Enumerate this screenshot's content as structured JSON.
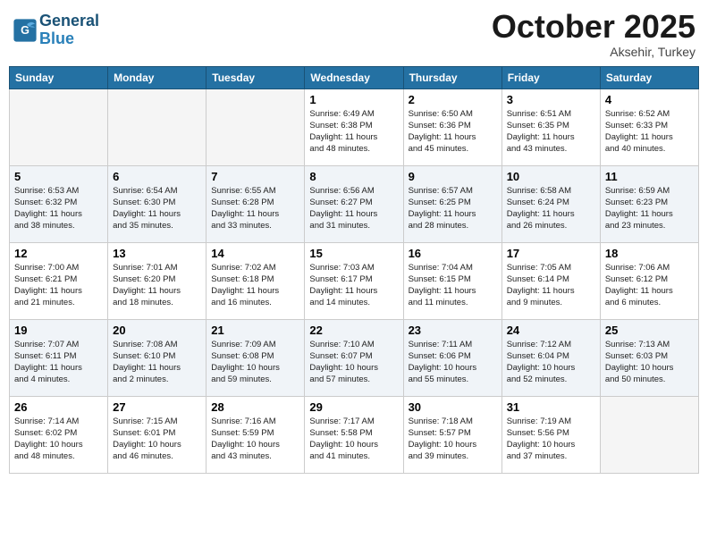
{
  "header": {
    "logo_line1": "General",
    "logo_line2": "Blue",
    "month": "October 2025",
    "location": "Aksehir, Turkey"
  },
  "weekdays": [
    "Sunday",
    "Monday",
    "Tuesday",
    "Wednesday",
    "Thursday",
    "Friday",
    "Saturday"
  ],
  "weeks": [
    [
      {
        "day": "",
        "info": ""
      },
      {
        "day": "",
        "info": ""
      },
      {
        "day": "",
        "info": ""
      },
      {
        "day": "1",
        "info": "Sunrise: 6:49 AM\nSunset: 6:38 PM\nDaylight: 11 hours\nand 48 minutes."
      },
      {
        "day": "2",
        "info": "Sunrise: 6:50 AM\nSunset: 6:36 PM\nDaylight: 11 hours\nand 45 minutes."
      },
      {
        "day": "3",
        "info": "Sunrise: 6:51 AM\nSunset: 6:35 PM\nDaylight: 11 hours\nand 43 minutes."
      },
      {
        "day": "4",
        "info": "Sunrise: 6:52 AM\nSunset: 6:33 PM\nDaylight: 11 hours\nand 40 minutes."
      }
    ],
    [
      {
        "day": "5",
        "info": "Sunrise: 6:53 AM\nSunset: 6:32 PM\nDaylight: 11 hours\nand 38 minutes."
      },
      {
        "day": "6",
        "info": "Sunrise: 6:54 AM\nSunset: 6:30 PM\nDaylight: 11 hours\nand 35 minutes."
      },
      {
        "day": "7",
        "info": "Sunrise: 6:55 AM\nSunset: 6:28 PM\nDaylight: 11 hours\nand 33 minutes."
      },
      {
        "day": "8",
        "info": "Sunrise: 6:56 AM\nSunset: 6:27 PM\nDaylight: 11 hours\nand 31 minutes."
      },
      {
        "day": "9",
        "info": "Sunrise: 6:57 AM\nSunset: 6:25 PM\nDaylight: 11 hours\nand 28 minutes."
      },
      {
        "day": "10",
        "info": "Sunrise: 6:58 AM\nSunset: 6:24 PM\nDaylight: 11 hours\nand 26 minutes."
      },
      {
        "day": "11",
        "info": "Sunrise: 6:59 AM\nSunset: 6:23 PM\nDaylight: 11 hours\nand 23 minutes."
      }
    ],
    [
      {
        "day": "12",
        "info": "Sunrise: 7:00 AM\nSunset: 6:21 PM\nDaylight: 11 hours\nand 21 minutes."
      },
      {
        "day": "13",
        "info": "Sunrise: 7:01 AM\nSunset: 6:20 PM\nDaylight: 11 hours\nand 18 minutes."
      },
      {
        "day": "14",
        "info": "Sunrise: 7:02 AM\nSunset: 6:18 PM\nDaylight: 11 hours\nand 16 minutes."
      },
      {
        "day": "15",
        "info": "Sunrise: 7:03 AM\nSunset: 6:17 PM\nDaylight: 11 hours\nand 14 minutes."
      },
      {
        "day": "16",
        "info": "Sunrise: 7:04 AM\nSunset: 6:15 PM\nDaylight: 11 hours\nand 11 minutes."
      },
      {
        "day": "17",
        "info": "Sunrise: 7:05 AM\nSunset: 6:14 PM\nDaylight: 11 hours\nand 9 minutes."
      },
      {
        "day": "18",
        "info": "Sunrise: 7:06 AM\nSunset: 6:12 PM\nDaylight: 11 hours\nand 6 minutes."
      }
    ],
    [
      {
        "day": "19",
        "info": "Sunrise: 7:07 AM\nSunset: 6:11 PM\nDaylight: 11 hours\nand 4 minutes."
      },
      {
        "day": "20",
        "info": "Sunrise: 7:08 AM\nSunset: 6:10 PM\nDaylight: 11 hours\nand 2 minutes."
      },
      {
        "day": "21",
        "info": "Sunrise: 7:09 AM\nSunset: 6:08 PM\nDaylight: 10 hours\nand 59 minutes."
      },
      {
        "day": "22",
        "info": "Sunrise: 7:10 AM\nSunset: 6:07 PM\nDaylight: 10 hours\nand 57 minutes."
      },
      {
        "day": "23",
        "info": "Sunrise: 7:11 AM\nSunset: 6:06 PM\nDaylight: 10 hours\nand 55 minutes."
      },
      {
        "day": "24",
        "info": "Sunrise: 7:12 AM\nSunset: 6:04 PM\nDaylight: 10 hours\nand 52 minutes."
      },
      {
        "day": "25",
        "info": "Sunrise: 7:13 AM\nSunset: 6:03 PM\nDaylight: 10 hours\nand 50 minutes."
      }
    ],
    [
      {
        "day": "26",
        "info": "Sunrise: 7:14 AM\nSunset: 6:02 PM\nDaylight: 10 hours\nand 48 minutes."
      },
      {
        "day": "27",
        "info": "Sunrise: 7:15 AM\nSunset: 6:01 PM\nDaylight: 10 hours\nand 46 minutes."
      },
      {
        "day": "28",
        "info": "Sunrise: 7:16 AM\nSunset: 5:59 PM\nDaylight: 10 hours\nand 43 minutes."
      },
      {
        "day": "29",
        "info": "Sunrise: 7:17 AM\nSunset: 5:58 PM\nDaylight: 10 hours\nand 41 minutes."
      },
      {
        "day": "30",
        "info": "Sunrise: 7:18 AM\nSunset: 5:57 PM\nDaylight: 10 hours\nand 39 minutes."
      },
      {
        "day": "31",
        "info": "Sunrise: 7:19 AM\nSunset: 5:56 PM\nDaylight: 10 hours\nand 37 minutes."
      },
      {
        "day": "",
        "info": ""
      }
    ]
  ]
}
